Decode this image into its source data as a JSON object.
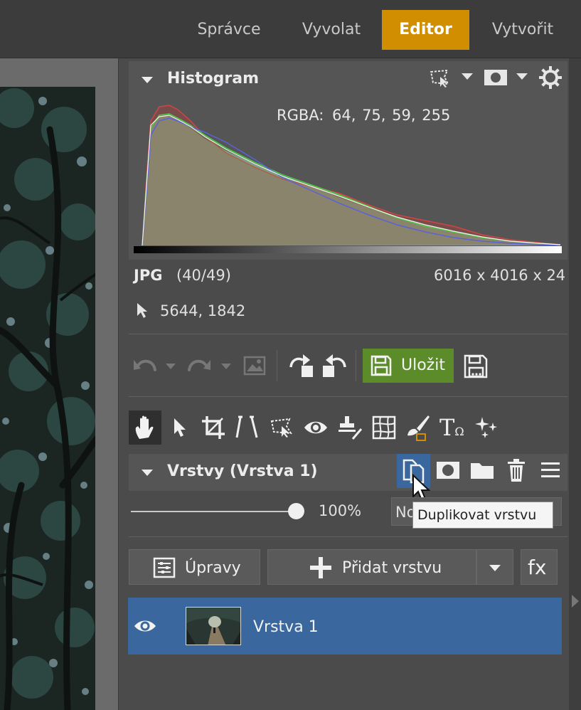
{
  "nav": {
    "tabs": [
      {
        "label": "Správce"
      },
      {
        "label": "Vyvolat"
      },
      {
        "label": "Editor"
      },
      {
        "label": "Vytvořit"
      }
    ],
    "active_tab": "Editor",
    "accent_color": "#d08e00"
  },
  "histogram": {
    "title": "Histogram",
    "rgba_label": "RGBA:",
    "rgba_value": "64,  75,  59, 255",
    "format": "JPG",
    "index": "(40/49)",
    "dimensions": "6016 x 4016 x 24",
    "cursor_position": "5644, 1842"
  },
  "toolbar": {
    "save_label": "Uložit",
    "save_color": "#5c8c2a"
  },
  "tools": [
    "hand-tool",
    "select-tool",
    "crop-tool",
    "straighten-tool",
    "selection-tool",
    "red-eye-tool",
    "clone-stamp-tool",
    "perspective-tool",
    "brush-tool",
    "text-tool",
    "effects-tool"
  ],
  "layers": {
    "title": "Vrstvy (Vrstva 1)",
    "opacity": "100%",
    "opacity_value": 1.0,
    "blend_mode_partial": "No",
    "adjustments_label": "Úpravy",
    "add_layer_label": "Přidat vrstvu",
    "fx_label": "fx",
    "items": [
      {
        "name": "Vrstva 1",
        "visible": true,
        "selected": true
      }
    ],
    "selected_color": "#3a679e"
  },
  "tooltip": {
    "text": "Duplikovat vrstvu"
  }
}
